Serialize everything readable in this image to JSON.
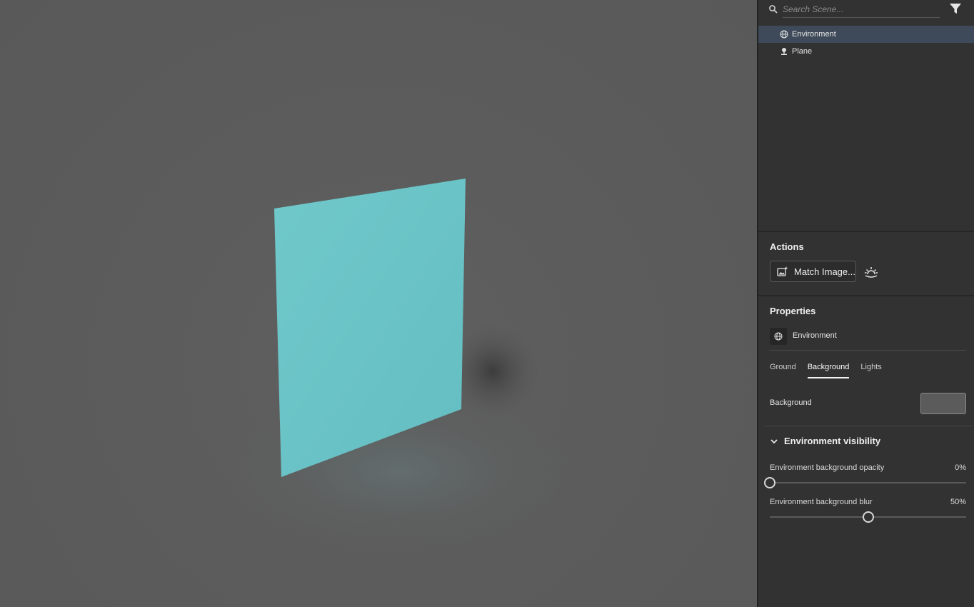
{
  "search": {
    "placeholder": "Search Scene..."
  },
  "scene_tree": [
    {
      "label": "Environment",
      "icon": "globe-icon",
      "selected": true
    },
    {
      "label": "Plane",
      "icon": "plane-object-icon",
      "selected": false
    }
  ],
  "actions": {
    "title": "Actions",
    "match_image_label": "Match Image..."
  },
  "properties": {
    "title": "Properties",
    "object_label": "Environment",
    "tabs": [
      "Ground",
      "Background",
      "Lights"
    ],
    "active_tab": "Background",
    "background_label": "Background",
    "background_color": "#5b5b5b"
  },
  "environment_visibility": {
    "title": "Environment visibility",
    "opacity": {
      "label": "Environment background opacity",
      "value_text": "0%",
      "value": 0
    },
    "blur": {
      "label": "Environment background blur",
      "value_text": "50%",
      "value": 50
    }
  },
  "colors": {
    "plane": "#6bc3c6",
    "viewport_bg": "#5b5b5b",
    "panel_bg": "#323232",
    "selection": "#3e4a59"
  }
}
